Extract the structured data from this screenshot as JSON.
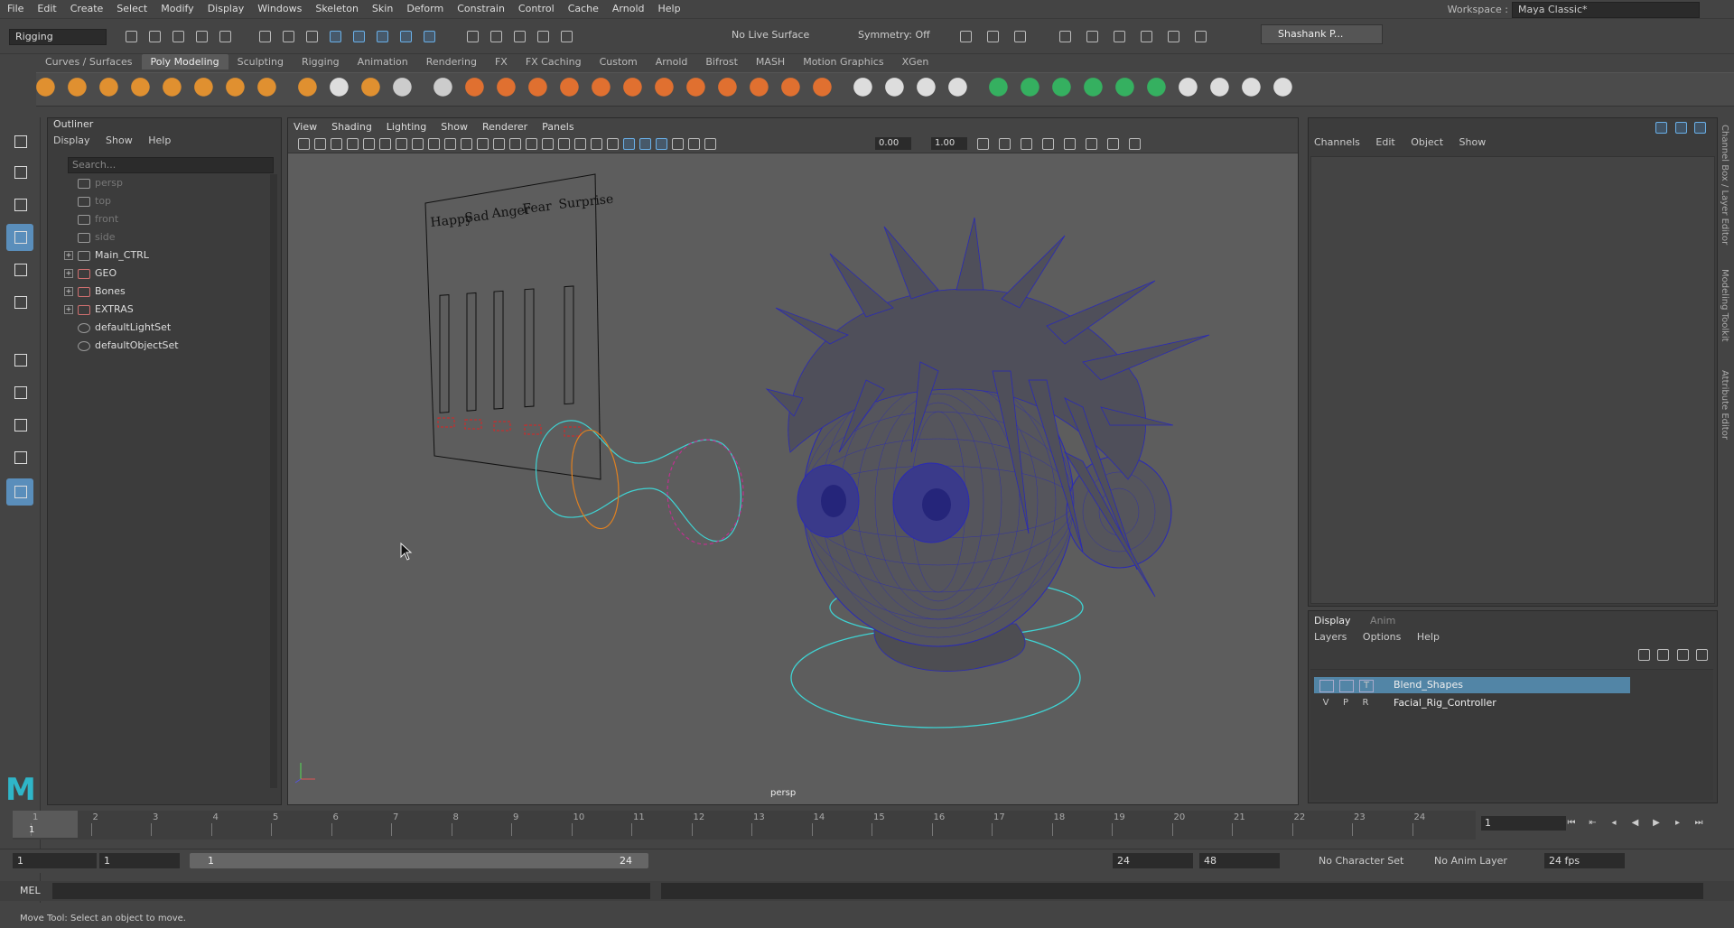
{
  "menubar": {
    "items": [
      "File",
      "Edit",
      "Create",
      "Select",
      "Modify",
      "Display",
      "Windows",
      "Skeleton",
      "Skin",
      "Deform",
      "Constrain",
      "Control",
      "Cache",
      "Arnold",
      "Help"
    ],
    "workspace_label": "Workspace :",
    "workspace_value": "Maya Classic*"
  },
  "statusline": {
    "mode": "Rigging",
    "live_surface": "No Live Surface",
    "symmetry": "Symmetry: Off",
    "user": "Shashank P..."
  },
  "shelf": {
    "tabs": [
      "Curves / Surfaces",
      "Poly Modeling",
      "Sculpting",
      "Rigging",
      "Animation",
      "Rendering",
      "FX",
      "FX Caching",
      "Custom",
      "Arnold",
      "Bifrost",
      "MASH",
      "Motion Graphics",
      "XGen"
    ],
    "active_tab": "Poly Modeling",
    "icon_names": [
      "sphere-icon",
      "cube-icon",
      "cylinder-icon",
      "cone-icon",
      "torus-icon",
      "plane-icon",
      "disc-icon",
      "platonic-icon",
      "star-icon",
      "text-icon",
      "svg-icon",
      "sweep-icon",
      "poly-count-icon",
      "combine-icon",
      "separate-icon",
      "extract-icon",
      "booleans-icon",
      "smooth-icon",
      "mirror-icon",
      "reduce-icon",
      "bevel-icon",
      "bridge-icon",
      "extrude-icon",
      "fill-hole-icon",
      "merge-icon",
      "multi-cut-icon",
      "target-weld-icon",
      "connect-icon",
      "insert-loop-icon",
      "offset-loop-icon",
      "unfold-icon",
      "uv-icon",
      "transfer-icon",
      "planar-map-icon",
      "cylindrical-map-icon",
      "spherical-map-icon",
      "auto-map-icon",
      "tweak-icon",
      "symmetrize-icon"
    ]
  },
  "outliner": {
    "title": "Outliner",
    "menu": [
      "Display",
      "Show",
      "Help"
    ],
    "search_placeholder": "Search...",
    "items": [
      {
        "label": "persp",
        "dim": true,
        "type": "camera"
      },
      {
        "label": "top",
        "dim": true,
        "type": "camera"
      },
      {
        "label": "front",
        "dim": true,
        "type": "camera"
      },
      {
        "label": "side",
        "dim": true,
        "type": "camera"
      },
      {
        "label": "Main_CTRL",
        "dim": false,
        "type": "curve",
        "expand": true
      },
      {
        "label": "GEO",
        "dim": false,
        "type": "group",
        "expand": true
      },
      {
        "label": "Bones",
        "dim": false,
        "type": "group",
        "expand": true
      },
      {
        "label": "EXTRAS",
        "dim": false,
        "type": "group",
        "expand": true
      },
      {
        "label": "defaultLightSet",
        "dim": false,
        "type": "set"
      },
      {
        "label": "defaultObjectSet",
        "dim": false,
        "type": "set"
      }
    ]
  },
  "viewport": {
    "menu": [
      "View",
      "Shading",
      "Lighting",
      "Show",
      "Renderer",
      "Panels"
    ],
    "field_a": "0.00",
    "field_b": "1.00",
    "camera_label": "persp",
    "board_labels": [
      "Happy",
      "Sad",
      "Anger",
      "Fear",
      "Surprise"
    ]
  },
  "channelbox": {
    "menu": [
      "Channels",
      "Edit",
      "Object",
      "Show"
    ],
    "side_tabs": [
      "Channel Box / Layer Editor",
      "Modeling Toolkit",
      "Attribute Editor"
    ]
  },
  "layer_editor": {
    "tabs": [
      "Display",
      "Anim"
    ],
    "menu": [
      "Layers",
      "Options",
      "Help"
    ],
    "layers": [
      {
        "name": "Blend_Shapes",
        "v": "",
        "p": "",
        "r": "T",
        "selected": true
      },
      {
        "name": "Facial_Rig_Controller",
        "v": "V",
        "p": "P",
        "r": "R",
        "selected": false
      }
    ]
  },
  "timeline": {
    "ticks": [
      "1",
      "2",
      "3",
      "4",
      "5",
      "6",
      "7",
      "8",
      "9",
      "10",
      "11",
      "12",
      "13",
      "14",
      "15",
      "16",
      "17",
      "18",
      "19",
      "20",
      "21",
      "22",
      "23",
      "24"
    ],
    "current_frame": "1",
    "current_field": "1"
  },
  "range": {
    "start_time": "1",
    "playback_start": "1",
    "slider_start": "1",
    "slider_end": "24",
    "playback_end": "24",
    "end_time": "48",
    "character_set": "No Character Set",
    "anim_layer": "No Anim Layer",
    "fps": "24 fps"
  },
  "command": {
    "mel_label": "MEL"
  },
  "helpline": {
    "text": "Move Tool: Select an object to move."
  },
  "colors": {
    "accent": "#5285a6",
    "curve_cyan": "#3fd3d3",
    "wire_blue": "#2a2ab5",
    "maya_logo": "#2fb5c8"
  }
}
